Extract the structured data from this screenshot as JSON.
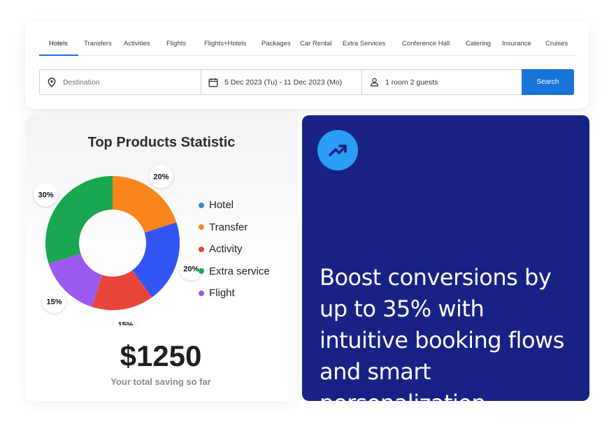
{
  "search_widget": {
    "tabs": [
      {
        "label": "Hotels",
        "active": true
      },
      {
        "label": "Transfers"
      },
      {
        "label": "Activities"
      },
      {
        "label": "Flights"
      },
      {
        "label": "Flights+Hotels"
      },
      {
        "label": "Packages"
      },
      {
        "label": "Car Rental"
      },
      {
        "label": "Extra Services"
      },
      {
        "label": "Conference Hall"
      },
      {
        "label": "Catering"
      },
      {
        "label": "Insurance"
      },
      {
        "label": "Cruises"
      }
    ],
    "destination": {
      "placeholder": "Destination",
      "value": "",
      "icon": "location-pin-icon"
    },
    "dates": {
      "value": "5 Dec 2023 (Tu) - 11 Dec 2023 (Mo)",
      "icon": "calendar-icon"
    },
    "guests": {
      "value": "1 room 2 guests",
      "icon": "person-icon"
    },
    "search_label": "Search",
    "accent_color": "#1a73d9"
  },
  "stats": {
    "title": "Top Products Statistic",
    "total_amount": "$1250",
    "total_caption": "Your total saving so far",
    "legend": [
      {
        "label": "Hotel",
        "color": "#2f8fe0"
      },
      {
        "label": "Transfer",
        "color": "#f8861c"
      },
      {
        "label": "Activity",
        "color": "#e8453a"
      },
      {
        "label": "Extra service",
        "color": "#18a64f"
      },
      {
        "label": "Flight",
        "color": "#9b59f0"
      }
    ]
  },
  "chart_data": {
    "type": "pie",
    "variant": "donut",
    "slices": [
      {
        "label": "Transfer",
        "value": 20,
        "display": "20%",
        "color": "#f8861c"
      },
      {
        "label": "Hotel",
        "value": 20,
        "display": "20%",
        "color": "#3355f5"
      },
      {
        "label": "Activity",
        "value": 15,
        "display": "15%",
        "color": "#e8453a"
      },
      {
        "label": "Flight",
        "value": 15,
        "display": "15%",
        "color": "#9b59f0"
      },
      {
        "label": "Extra service",
        "value": 30,
        "display": "30%",
        "color": "#18a64f"
      }
    ]
  },
  "promo": {
    "icon": "trending-up-icon",
    "text": "Boost conversions by up to 35% with intuitive booking flows and smart personalization.",
    "background": "#182285",
    "icon_background": "#2b9df2"
  }
}
